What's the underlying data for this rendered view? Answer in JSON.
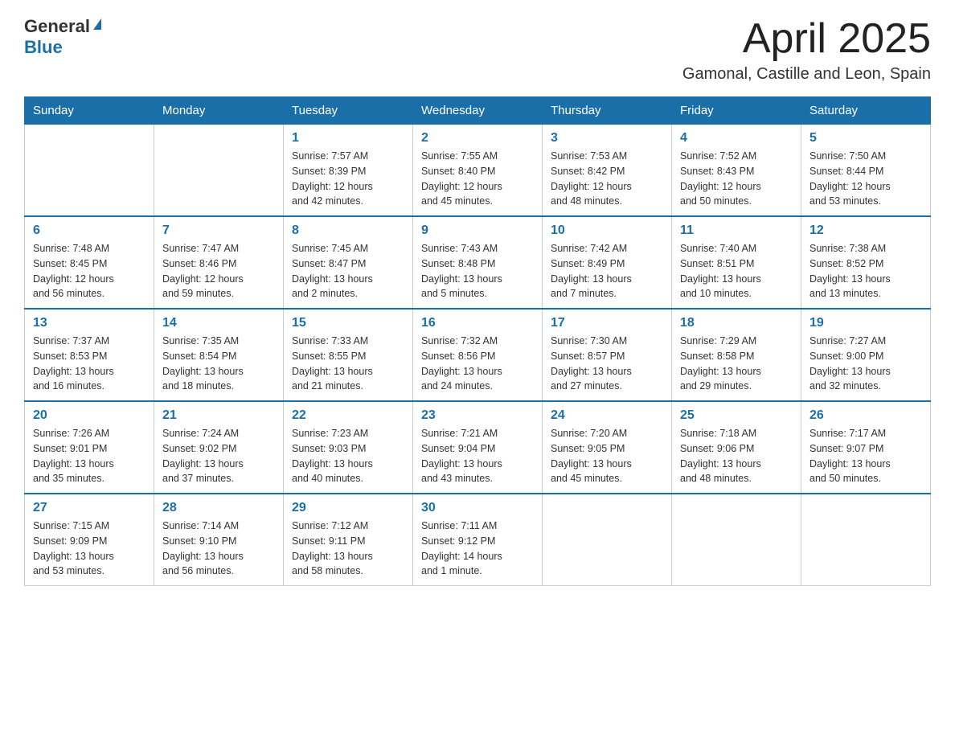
{
  "header": {
    "logo_general": "General",
    "logo_blue": "Blue",
    "month_title": "April 2025",
    "location": "Gamonal, Castille and Leon, Spain"
  },
  "weekdays": [
    "Sunday",
    "Monday",
    "Tuesday",
    "Wednesday",
    "Thursday",
    "Friday",
    "Saturday"
  ],
  "weeks": [
    [
      {
        "day": "",
        "info": ""
      },
      {
        "day": "",
        "info": ""
      },
      {
        "day": "1",
        "info": "Sunrise: 7:57 AM\nSunset: 8:39 PM\nDaylight: 12 hours\nand 42 minutes."
      },
      {
        "day": "2",
        "info": "Sunrise: 7:55 AM\nSunset: 8:40 PM\nDaylight: 12 hours\nand 45 minutes."
      },
      {
        "day": "3",
        "info": "Sunrise: 7:53 AM\nSunset: 8:42 PM\nDaylight: 12 hours\nand 48 minutes."
      },
      {
        "day": "4",
        "info": "Sunrise: 7:52 AM\nSunset: 8:43 PM\nDaylight: 12 hours\nand 50 minutes."
      },
      {
        "day": "5",
        "info": "Sunrise: 7:50 AM\nSunset: 8:44 PM\nDaylight: 12 hours\nand 53 minutes."
      }
    ],
    [
      {
        "day": "6",
        "info": "Sunrise: 7:48 AM\nSunset: 8:45 PM\nDaylight: 12 hours\nand 56 minutes."
      },
      {
        "day": "7",
        "info": "Sunrise: 7:47 AM\nSunset: 8:46 PM\nDaylight: 12 hours\nand 59 minutes."
      },
      {
        "day": "8",
        "info": "Sunrise: 7:45 AM\nSunset: 8:47 PM\nDaylight: 13 hours\nand 2 minutes."
      },
      {
        "day": "9",
        "info": "Sunrise: 7:43 AM\nSunset: 8:48 PM\nDaylight: 13 hours\nand 5 minutes."
      },
      {
        "day": "10",
        "info": "Sunrise: 7:42 AM\nSunset: 8:49 PM\nDaylight: 13 hours\nand 7 minutes."
      },
      {
        "day": "11",
        "info": "Sunrise: 7:40 AM\nSunset: 8:51 PM\nDaylight: 13 hours\nand 10 minutes."
      },
      {
        "day": "12",
        "info": "Sunrise: 7:38 AM\nSunset: 8:52 PM\nDaylight: 13 hours\nand 13 minutes."
      }
    ],
    [
      {
        "day": "13",
        "info": "Sunrise: 7:37 AM\nSunset: 8:53 PM\nDaylight: 13 hours\nand 16 minutes."
      },
      {
        "day": "14",
        "info": "Sunrise: 7:35 AM\nSunset: 8:54 PM\nDaylight: 13 hours\nand 18 minutes."
      },
      {
        "day": "15",
        "info": "Sunrise: 7:33 AM\nSunset: 8:55 PM\nDaylight: 13 hours\nand 21 minutes."
      },
      {
        "day": "16",
        "info": "Sunrise: 7:32 AM\nSunset: 8:56 PM\nDaylight: 13 hours\nand 24 minutes."
      },
      {
        "day": "17",
        "info": "Sunrise: 7:30 AM\nSunset: 8:57 PM\nDaylight: 13 hours\nand 27 minutes."
      },
      {
        "day": "18",
        "info": "Sunrise: 7:29 AM\nSunset: 8:58 PM\nDaylight: 13 hours\nand 29 minutes."
      },
      {
        "day": "19",
        "info": "Sunrise: 7:27 AM\nSunset: 9:00 PM\nDaylight: 13 hours\nand 32 minutes."
      }
    ],
    [
      {
        "day": "20",
        "info": "Sunrise: 7:26 AM\nSunset: 9:01 PM\nDaylight: 13 hours\nand 35 minutes."
      },
      {
        "day": "21",
        "info": "Sunrise: 7:24 AM\nSunset: 9:02 PM\nDaylight: 13 hours\nand 37 minutes."
      },
      {
        "day": "22",
        "info": "Sunrise: 7:23 AM\nSunset: 9:03 PM\nDaylight: 13 hours\nand 40 minutes."
      },
      {
        "day": "23",
        "info": "Sunrise: 7:21 AM\nSunset: 9:04 PM\nDaylight: 13 hours\nand 43 minutes."
      },
      {
        "day": "24",
        "info": "Sunrise: 7:20 AM\nSunset: 9:05 PM\nDaylight: 13 hours\nand 45 minutes."
      },
      {
        "day": "25",
        "info": "Sunrise: 7:18 AM\nSunset: 9:06 PM\nDaylight: 13 hours\nand 48 minutes."
      },
      {
        "day": "26",
        "info": "Sunrise: 7:17 AM\nSunset: 9:07 PM\nDaylight: 13 hours\nand 50 minutes."
      }
    ],
    [
      {
        "day": "27",
        "info": "Sunrise: 7:15 AM\nSunset: 9:09 PM\nDaylight: 13 hours\nand 53 minutes."
      },
      {
        "day": "28",
        "info": "Sunrise: 7:14 AM\nSunset: 9:10 PM\nDaylight: 13 hours\nand 56 minutes."
      },
      {
        "day": "29",
        "info": "Sunrise: 7:12 AM\nSunset: 9:11 PM\nDaylight: 13 hours\nand 58 minutes."
      },
      {
        "day": "30",
        "info": "Sunrise: 7:11 AM\nSunset: 9:12 PM\nDaylight: 14 hours\nand 1 minute."
      },
      {
        "day": "",
        "info": ""
      },
      {
        "day": "",
        "info": ""
      },
      {
        "day": "",
        "info": ""
      }
    ]
  ]
}
